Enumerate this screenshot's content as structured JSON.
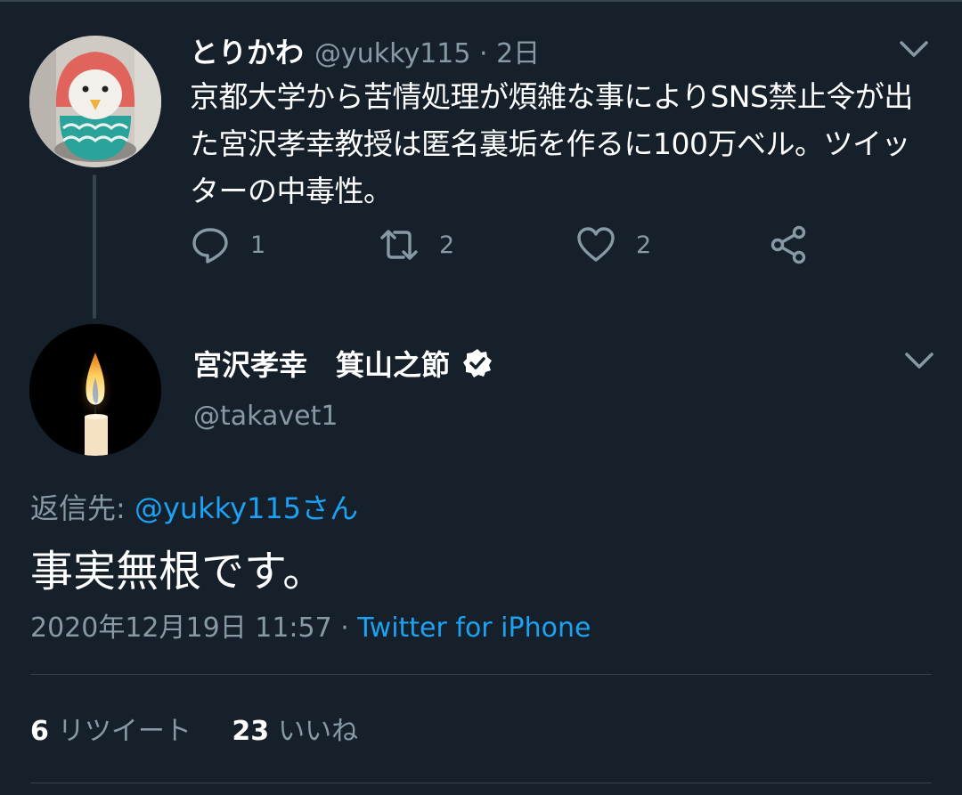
{
  "parent_tweet": {
    "author_name": "とりかわ",
    "handle_time": "@yukky115 · 2日",
    "text": "京都大学から苦情処理が煩雑な事によりSNS禁止令が出た宮沢孝幸教授は匿名裏垢を作るに100万ベル。ツイッターの中毒性。",
    "actions": {
      "reply_count": "1",
      "retweet_count": "2",
      "like_count": "2"
    },
    "avatar_icon": "amabie-doll-avatar"
  },
  "reply_tweet": {
    "author_name": "宮沢孝幸　箕山之節",
    "verified_icon": "verified-badge-icon",
    "handle": "@takavet1",
    "avatar_icon": "candle-avatar",
    "reply_to_label": "返信先: ",
    "reply_to_handle": "@yukky115さん",
    "text": "事実無根です。",
    "timestamp": "2020年12月19日 11:57 · ",
    "source": "Twitter for iPhone",
    "stats": {
      "retweets_count": "6",
      "retweets_label": "リツイート",
      "likes_count": "23",
      "likes_label": "いいね"
    }
  },
  "colors": {
    "background": "#15202b",
    "secondary_text": "#8899a6",
    "link": "#1da1f2",
    "divider": "#38444d"
  }
}
